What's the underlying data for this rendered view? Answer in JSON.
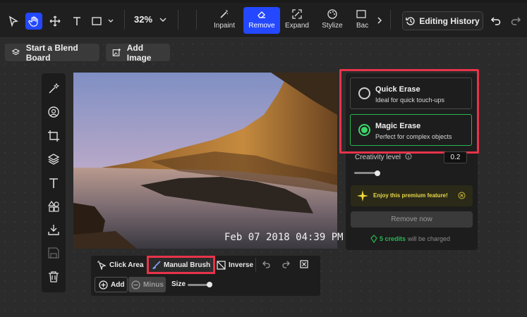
{
  "toolbar": {
    "zoom": "32%",
    "modes": [
      {
        "label": "Inpaint",
        "icon": "magic-wand-icon"
      },
      {
        "label": "Remove",
        "icon": "eraser-icon"
      },
      {
        "label": "Expand",
        "icon": "expand-icon"
      },
      {
        "label": "Stylize",
        "icon": "palette-icon"
      },
      {
        "label": "Bac",
        "icon": "background-icon"
      }
    ],
    "active_mode": "Remove",
    "history_label": "Editing History",
    "active_tool": "hand"
  },
  "actions": {
    "blend_board": "Start a Blend Board",
    "add_image": "Add Image"
  },
  "image": {
    "timestamp": "Feb 07 2018 04:39 PM"
  },
  "erase_panel": {
    "options": [
      {
        "title": "Quick Erase",
        "subtitle": "Ideal for quick touch-ups",
        "selected": false
      },
      {
        "title": "Magic Erase",
        "subtitle": "Perfect for complex objects",
        "selected": true
      }
    ],
    "creativity_label": "Creativity level",
    "creativity_value": "0.2",
    "premium_text": "Enjoy this premium feature!",
    "remove_label": "Remove now",
    "credits_green": "5 credits",
    "credits_rest": "will be charged"
  },
  "brush_bar": {
    "click_area": "Click Area",
    "manual_brush": "Manual Brush",
    "inverse": "Inverse",
    "add": "Add",
    "minus": "Minus",
    "size": "Size"
  },
  "colors": {
    "accent": "#2448ff",
    "highlight_red": "#e8334a",
    "success_green": "#29b653",
    "premium_yellow": "#e8d74a"
  }
}
